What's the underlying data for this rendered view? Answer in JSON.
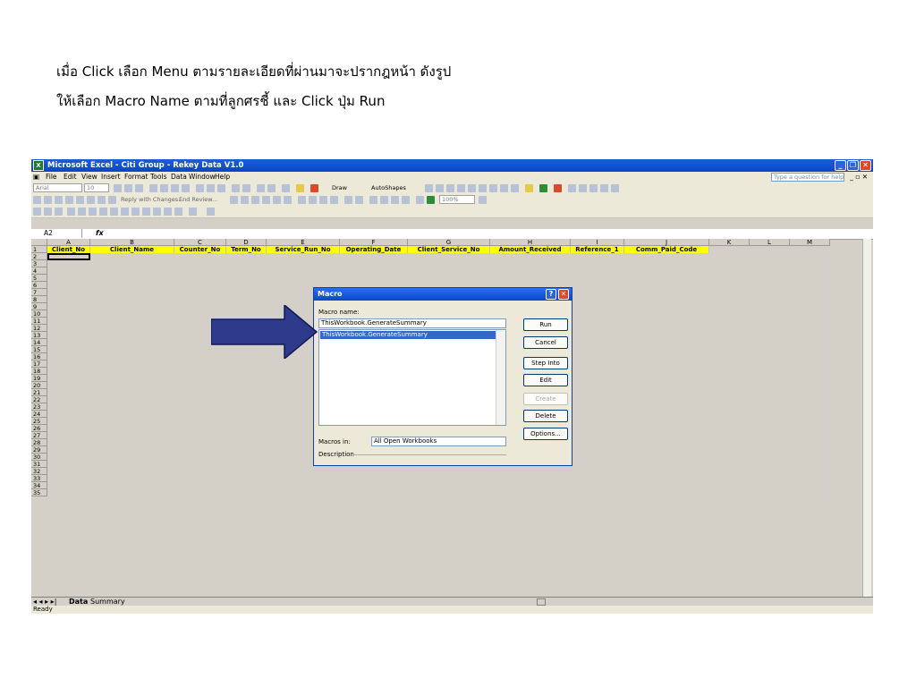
{
  "captions": {
    "line1": "เมื่อ Click เลือก Menu ตามรายละเอียดที่ผ่านมาจะปรากฎหน้า ดังรูป",
    "line2": "ให้เลือก Macro Name ตามที่ลูกศรชี้ และ Click ปุ่ม Run"
  },
  "window": {
    "title": "Microsoft Excel - Citi Group - Rekey Data V1.0",
    "app_icon": "excel-icon",
    "controls": [
      "minimize-icon",
      "restore-icon",
      "close-icon"
    ]
  },
  "menu": {
    "items": [
      "File",
      "Edit",
      "View",
      "Insert",
      "Format",
      "Tools",
      "Data",
      "Window",
      "Help"
    ],
    "help_box_placeholder": "Type a question for help"
  },
  "toolbar": {
    "font_name": "Arial",
    "font_size": "10",
    "reply_with_changes": "Reply with Changes...",
    "end_review": "End Review...",
    "draw": "Draw",
    "autoshapes": "AutoShapes",
    "zoom": "100%"
  },
  "formula_bar": {
    "name_box": "A2",
    "fx": "fx"
  },
  "sheet": {
    "column_letters": [
      "A",
      "B",
      "C",
      "D",
      "E",
      "F",
      "G",
      "H",
      "I",
      "J",
      "K",
      "L",
      "M"
    ],
    "header_row": [
      "Client_No",
      "Client_Name",
      "Counter_No",
      "Term_No",
      "Service_Run_No",
      "Operating_Date",
      "Client_Service_No",
      "Amount_Received",
      "Reference_1",
      "Comm_Paid_Code"
    ],
    "row_numbers": [
      "1",
      "2",
      "3",
      "4",
      "5",
      "6",
      "7",
      "8",
      "9",
      "10",
      "11",
      "12",
      "13",
      "14",
      "15",
      "16",
      "17",
      "18",
      "19",
      "20",
      "21",
      "22",
      "23",
      "24",
      "25",
      "26",
      "27",
      "28",
      "29",
      "30",
      "31",
      "32",
      "33",
      "34",
      "35"
    ],
    "header_color": "#ffff00",
    "tabs": [
      "Data",
      "Summary"
    ],
    "active_tab": "Data"
  },
  "status": "Ready",
  "macro_dialog": {
    "title": "Macro",
    "name_label": "Macro name:",
    "name_value": "ThisWorkbook.GenerateSummary",
    "list_items": [
      "ThisWorkbook.GenerateSummary"
    ],
    "buttons": {
      "run": "Run",
      "cancel": "Cancel",
      "step_into": "Step Into",
      "edit": "Edit",
      "create": "Create",
      "delete": "Delete",
      "options": "Options..."
    },
    "macros_in_label": "Macros in:",
    "macros_in_value": "All Open Workbooks",
    "description_label": "Description"
  },
  "colors": {
    "title_blue": "#0b46c4",
    "selection_blue": "#316ac5",
    "arrow_fill": "#2e3a8c",
    "close_red": "#d9492a"
  }
}
